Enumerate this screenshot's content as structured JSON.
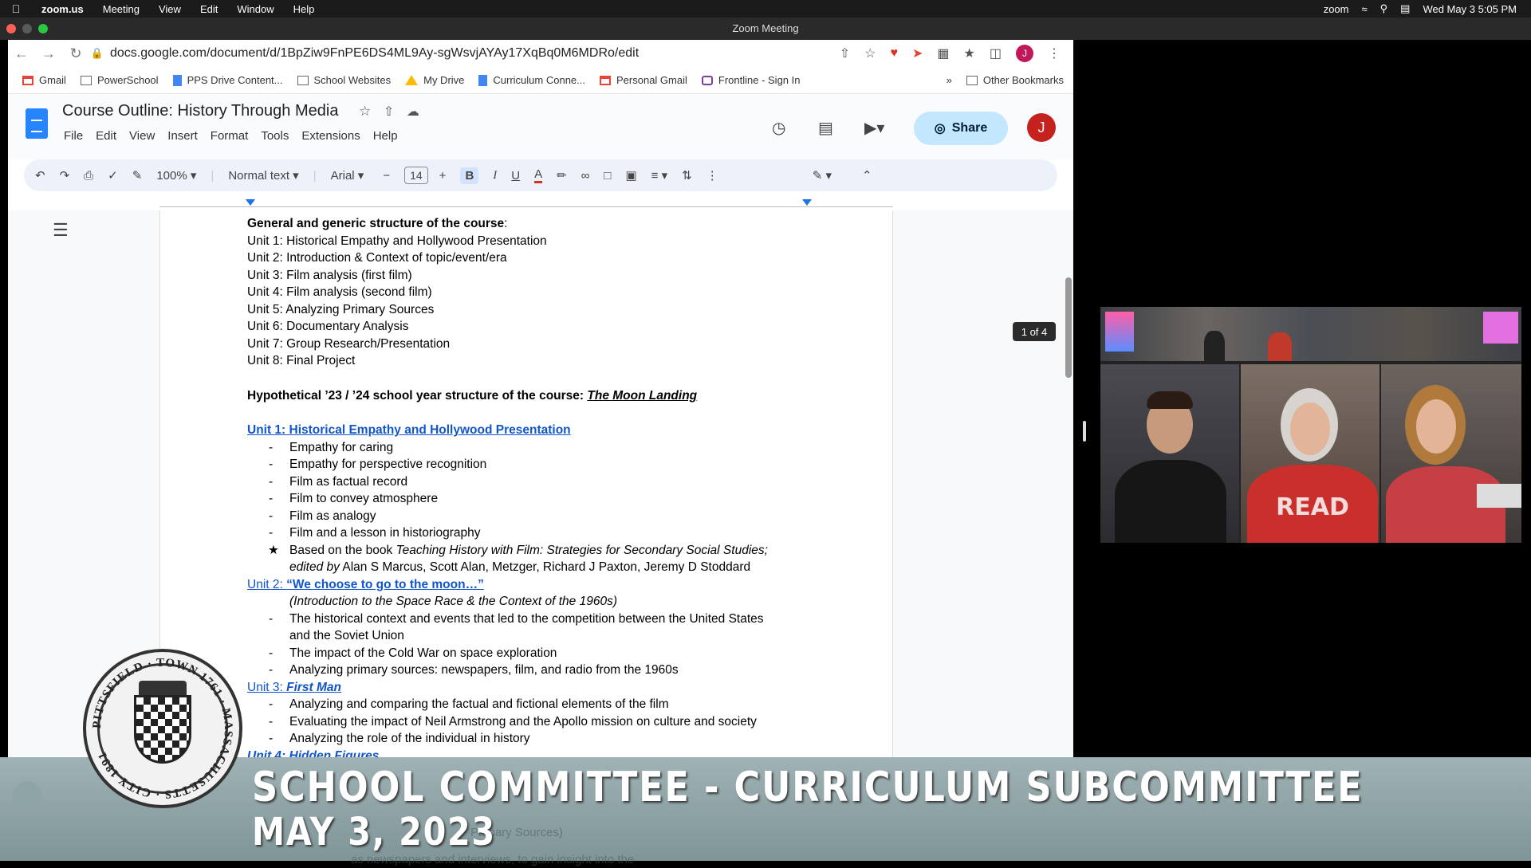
{
  "menubar": {
    "app": "zoom.us",
    "items": [
      "Meeting",
      "View",
      "Edit",
      "Window",
      "Help"
    ],
    "status_app": "zoom",
    "clock": "Wed May 3  5:05 PM"
  },
  "zoom_window": {
    "title": "Zoom Meeting"
  },
  "browser": {
    "url": "docs.google.com/document/d/1BpZiw9FnPE6DS4ML9Ay-sgWsvjAYAy17XqBq0M6MDRo/edit",
    "bookmarks": [
      "Gmail",
      "PowerSchool",
      "PPS Drive Content...",
      "School Websites",
      "My Drive",
      "Curriculum Conne...",
      "Personal Gmail",
      "Frontline - Sign In"
    ],
    "more_bookmarks": "»",
    "other_bookmarks": "Other Bookmarks"
  },
  "docs": {
    "title": "Course Outline: History Through Media",
    "menu": [
      "File",
      "Edit",
      "View",
      "Insert",
      "Format",
      "Tools",
      "Extensions",
      "Help"
    ],
    "share_label": "Share",
    "avatar_letter": "J",
    "toolbar": {
      "zoom": "100%",
      "style": "Normal text",
      "font": "Arial",
      "font_size": "14",
      "minus": "−",
      "plus": "+",
      "bold": "B",
      "italic": "I",
      "underline": "U",
      "text_color": "A"
    },
    "page_badge": "1 of 4",
    "content": {
      "general_heading": "General and generic structure of the course",
      "general_colon": ":",
      "units": [
        "Unit 1: Historical Empathy and Hollywood Presentation",
        "Unit 2: Introduction & Context of topic/event/era",
        "Unit 3: Film analysis (first film)",
        "Unit 4: Film analysis (second film)",
        "Unit 5: Analyzing Primary Sources",
        "Unit 6: Documentary Analysis",
        "Unit 7: Group Research/Presentation",
        "Unit 8: Final Project"
      ],
      "hypo_heading": "Hypothetical ’23 / ’24 school year structure of the course: ",
      "hypo_topic": "The Moon Landing",
      "unit1_link": "Unit 1: Historical Empathy and Hollywood Presentation",
      "unit1_bullets": [
        "Empathy for caring",
        "Empathy for perspective recognition",
        "Film as factual record",
        "Film to convey atmosphere",
        "Film as analogy",
        "Film and a lesson in historiography"
      ],
      "book_mark": "★",
      "book_prefix": "Based on the book ",
      "book_title": "Teaching History with Film: Strategies for Secondary Social Studies;",
      "book_edited_by": "edited by",
      "book_authors": " Alan S Marcus, Scott Alan, Metzger, Richard J Paxton, Jeremy D Stoddard",
      "unit2_link_prefix": "Unit 2: ",
      "unit2_link_title": "“We choose to go to the moon…”",
      "unit2_subtitle": "(Introduction to the Space Race & the Context of the 1960s)",
      "unit2_bullets": [
        "The historical context and events that led to the competition between the United States",
        "and the Soviet Union",
        "The impact of the Cold War on space exploration",
        "Analyzing primary sources: newspapers, film, and radio from the 1960s"
      ],
      "unit3_link_prefix": "Unit 3: ",
      "unit3_link_title": "First Man",
      "unit3_bullets": [
        "Analyzing and comparing the factual and fictional elements of the film",
        "Evaluating the impact of Neil Armstrong and the Apollo mission on culture and society",
        "Analyzing the role of the individual in history"
      ],
      "unit4_partial": "Unit 4: Hidden Figures"
    }
  },
  "overlay": {
    "line1": "SCHOOL COMMITTEE - CURRICULUM SUBCOMMITTEE",
    "line2": "MAY 3, 2023",
    "ghost_lines": [
      "Primary Sources)",
      "as newspapers and interviews, to gain insight into the"
    ],
    "seal_text": "PITTSFIELD · TOWN 1761 · MASSACHUSETTS · CITY 1891"
  },
  "colors": {
    "share_bg": "#c2e7ff",
    "link_blue": "#1155cc",
    "avatar_red": "#c5221f",
    "toolbar_bg": "#edf2fa"
  }
}
